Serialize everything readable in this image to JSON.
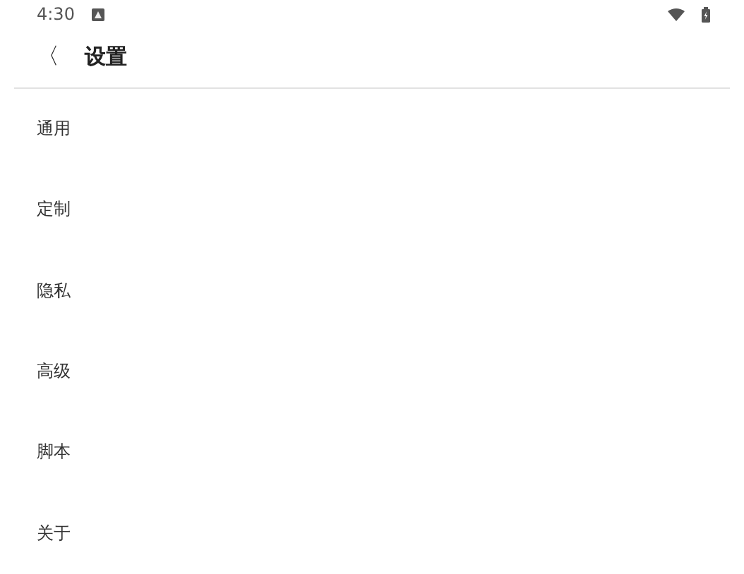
{
  "status_bar": {
    "time": "4:30"
  },
  "header": {
    "back": "〈",
    "title": "设置"
  },
  "items": [
    {
      "label": "通用"
    },
    {
      "label": "定制"
    },
    {
      "label": "隐私"
    },
    {
      "label": "高级"
    },
    {
      "label": "脚本"
    },
    {
      "label": "关于"
    }
  ]
}
